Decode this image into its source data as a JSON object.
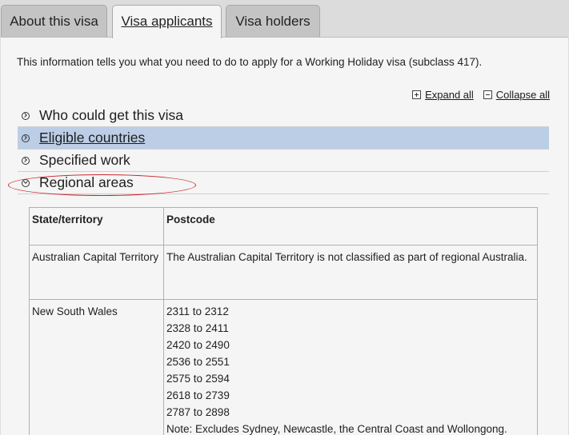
{
  "tabs": [
    {
      "label": "About this visa",
      "active": false
    },
    {
      "label": "Visa applicants",
      "active": true
    },
    {
      "label": "Visa holders",
      "active": false
    }
  ],
  "intro": "This information tells you what you need to do to apply for a Working Holiday visa (subclass 417).",
  "controls": {
    "expand_all": "Expand all",
    "collapse_all": "Collapse all"
  },
  "accordion": [
    {
      "label": "Who could get this visa",
      "expanded": false
    },
    {
      "label": "Eligible countries",
      "expanded": false,
      "highlighted": true
    },
    {
      "label": "Specified work",
      "expanded": false
    },
    {
      "label": "Regional areas",
      "expanded": true,
      "annotated": true
    }
  ],
  "table": {
    "headers": [
      "State/territory",
      "Postcode"
    ],
    "rows": [
      {
        "state": "Australian Capital Territory",
        "postcode": "The Australian Capital Territory is not classified as part of regional Australia."
      },
      {
        "state": "New South Wales",
        "postcodes": [
          "2311 to 2312",
          "2328 to 2411",
          "2420 to 2490",
          "2536 to 2551",
          "2575 to 2594",
          "2618 to 2739",
          "2787 to 2898"
        ],
        "note": "Note: Excludes Sydney, Newcastle, the Central Coast and Wollongong."
      }
    ]
  },
  "colors": {
    "highlight_row": "#bccde6",
    "annotation_circle": "#c8242b",
    "panel_bg": "#f5f5f5"
  }
}
